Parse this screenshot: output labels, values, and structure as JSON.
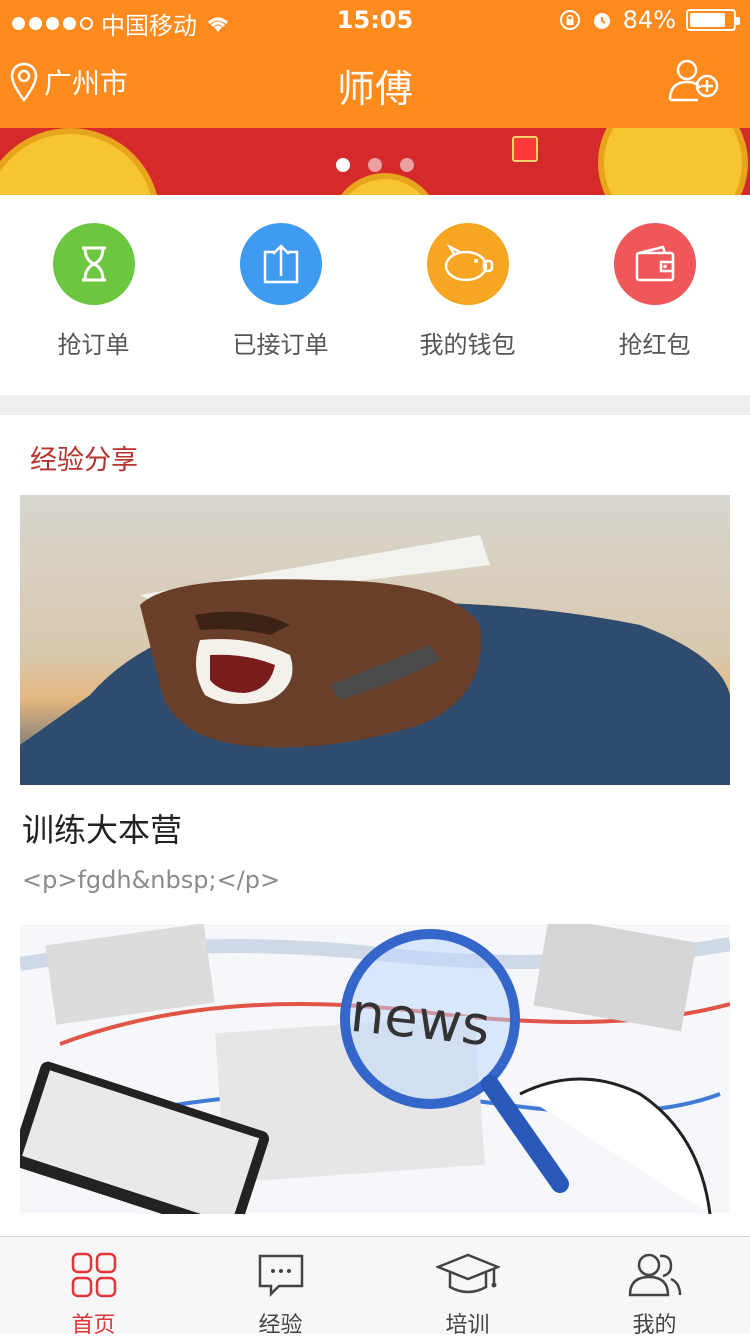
{
  "status_bar": {
    "carrier": "中国移动",
    "time": "15:05",
    "battery": "84%",
    "battery_level": 0.84
  },
  "nav": {
    "city": "广州市",
    "title": "师傅",
    "icons": {
      "location": "location-pin-icon",
      "add_user": "add-user-icon"
    }
  },
  "banner": {
    "slides": 3,
    "active_index": 0
  },
  "quick_menu": [
    {
      "label": "抢订单",
      "icon": "hourglass-icon",
      "color": "#6cc640"
    },
    {
      "label": "已接订单",
      "icon": "upload-icon",
      "color": "#3e9bf0"
    },
    {
      "label": "我的钱包",
      "icon": "piggy-bank-icon",
      "color": "#f6a623"
    },
    {
      "label": "抢红包",
      "icon": "wallet-icon",
      "color": "#f0575a"
    }
  ],
  "experience": {
    "section_title": "经验分享",
    "articles": [
      {
        "title": "训练大本营",
        "desc": "<p>fgdh&nbsp;</p>"
      }
    ]
  },
  "tabbar": [
    {
      "label": "首页",
      "icon": "home-grid-icon",
      "active": true
    },
    {
      "label": "经验",
      "icon": "chat-icon",
      "active": false
    },
    {
      "label": "培训",
      "icon": "graduation-cap-icon",
      "active": false
    },
    {
      "label": "我的",
      "icon": "user-icon",
      "active": false
    }
  ],
  "colors": {
    "brand": "#ff8a1e",
    "accent_red": "#e0353a",
    "section_title": "#b8322d"
  }
}
